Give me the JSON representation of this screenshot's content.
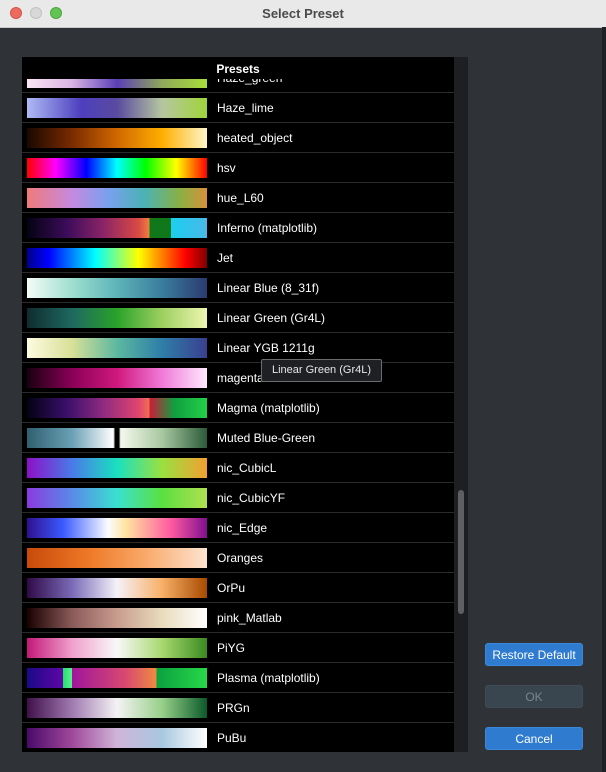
{
  "window": {
    "title": "Select Preset"
  },
  "list": {
    "header": "Presets",
    "items": [
      {
        "label": "Haze_green",
        "gradient": "linear-gradient(90deg,#fce4f4 0%,#d8b4e2 25%,#5a3fb5 50%,#8fa85a 75%,#a8dd3a 100%)"
      },
      {
        "label": "Haze_lime",
        "gradient": "linear-gradient(90deg,#aebaf5 0%,#4d3fbe 30%,#5a4aa0 50%,#b5c6a0 75%,#9fd43a 100%)"
      },
      {
        "label": "heated_object",
        "gradient": "linear-gradient(90deg,#1a0800 0%,#7a2b00 25%,#d06800 50%,#ffae00 75%,#fff6c8 100%)"
      },
      {
        "label": "hsv",
        "gradient": "linear-gradient(90deg,#ff0000 0%,#ff00ff 16%,#0000ff 33%,#00ffff 50%,#00ff00 66%,#ffff00 83%,#ff0000 100%)"
      },
      {
        "label": "hue_L60",
        "gradient": "linear-gradient(90deg,#f07a7a 0%,#c58ae0 25%,#7aa0ef 45%,#4ab2b5 65%,#8ab045 85%,#d8903a 100%)"
      },
      {
        "label": "Inferno (matplotlib)",
        "gradient": "linear-gradient(90deg,#050313 0%,#3b0c5a 22%,#8a2368 42%,#d94a44 62%,#f08040 68%,#10781a 68%,#10781a 80%,#1ad0f0 80%,#4ab8e8 100%)"
      },
      {
        "label": "Jet",
        "gradient": "linear-gradient(90deg,#00008f 0%,#0000ff 12%,#00ffff 38%,#80ff80 50%,#ffff00 62%,#ff0000 88%,#800000 100%)"
      },
      {
        "label": "Linear Blue (8_31f)",
        "gradient": "linear-gradient(90deg,#f4fbf6 0%,#9fdfd0 25%,#5db4b8 50%,#3a7d9e 75%,#2b3a70 100%)"
      },
      {
        "label": "Linear Green (Gr4L)",
        "gradient": "linear-gradient(90deg,#102c30 0%,#1e6860 25%,#2aa22a 50%,#9dd060 75%,#eef5b0 100%)"
      },
      {
        "label": "Linear YGB 1211g",
        "gradient": "linear-gradient(90deg,#fdfbe0 0%,#d8e098 25%,#5cb8a0 50%,#2e7ea8 75%,#3a3f90 100%)"
      },
      {
        "label": "magenta",
        "gradient": "linear-gradient(90deg,#1a0010 0%,#8a0058 25%,#d0187e 50%,#f07ad8 75%,#ffe8ff 100%)"
      },
      {
        "label": "Magma (matplotlib)",
        "gradient": "linear-gradient(90deg,#030214 0%,#3a0f6a 22%,#8d2a80 42%,#e04570 62%,#f07050 68%,#cd1a3a 68%,#10a040 82%,#22d048 100%)"
      },
      {
        "label": "Muted Blue-Green",
        "gradient": "linear-gradient(90deg,#2f6070 0%,#6aa0b5 25%,#ffffff 48%,#000000 49%,#000000 51%,#f5f8ee 52%,#a8c8a0 75%,#2c5a3a 100%)"
      },
      {
        "label": "nic_CubicL",
        "gradient": "linear-gradient(90deg,#8c10c8 0%,#4a7ae8 25%,#1ae0c0 50%,#9ae040 75%,#f2a030 100%)"
      },
      {
        "label": "nic_CubicYF",
        "gradient": "linear-gradient(90deg,#8a3ae0 0%,#5a8ae8 25%,#3ae0d0 50%,#5ae040 75%,#b0e050 100%)"
      },
      {
        "label": "nic_Edge",
        "gradient": "linear-gradient(90deg,#301090 0%,#3a5aff 20%,#fafcff 45%,#ffe4a0 55%,#ff5aa0 80%,#801090 100%)"
      },
      {
        "label": "Oranges",
        "gradient": "linear-gradient(90deg,#c84a0a 0%,#ee7a28 35%,#f9a868 65%,#fde4d0 100%)"
      },
      {
        "label": "OrPu",
        "gradient": "linear-gradient(90deg,#300a48 0%,#7a6ab8 25%,#f4f2f8 50%,#f8b068 75%,#a84a00 100%)"
      },
      {
        "label": "pink_Matlab",
        "gradient": "linear-gradient(90deg,#1a0000 0%,#8a5a5a 25%,#c89c8e 50%,#e8dcbc 75%,#ffffff 100%)"
      },
      {
        "label": "PiYG",
        "gradient": "linear-gradient(90deg,#c2187a 0%,#f0a0cc 25%,#f8f8f8 50%,#a8d870 75%,#3a8a20 100%)"
      },
      {
        "label": "Plasma (matplotlib)",
        "gradient": "linear-gradient(90deg,#1a0a88 0%,#5e06a6 20%,#20e070 20%,#60f090 25%,#a0169a 25%,#d84a70 55%,#f08a40 72%,#0aa040 72%,#28d848 100%)"
      },
      {
        "label": "PRGn",
        "gradient": "linear-gradient(90deg,#40104a 0%,#a07ab0 25%,#f4f2f4 50%,#98d08a 75%,#0a5a2a 100%)"
      },
      {
        "label": "PuBu",
        "gradient": "linear-gradient(90deg,#4a0a6a 0%,#a0489a 25%,#d0b4d8 50%,#a8c8e0 75%,#ffffff 100%)"
      }
    ]
  },
  "tooltip": {
    "text": "Linear Green (Gr4L)"
  },
  "buttons": {
    "restore_default": "Restore Default",
    "ok": "OK",
    "cancel": "Cancel"
  }
}
